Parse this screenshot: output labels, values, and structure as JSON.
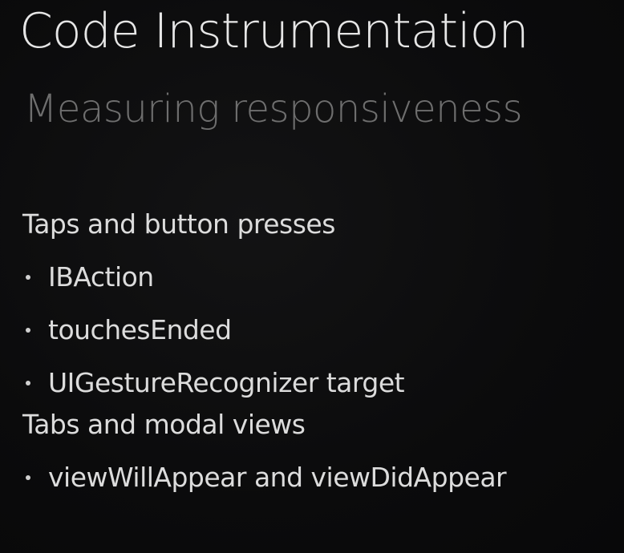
{
  "slide": {
    "title": "Code Instrumentation",
    "subtitle": "Measuring responsiveness",
    "sections": [
      {
        "heading": "Taps and button presses",
        "bullets": [
          "IBAction",
          "touchesEnded",
          "UIGestureRecognizer target"
        ]
      },
      {
        "heading": "Tabs and modal views",
        "bullets": [
          "viewWillAppear and viewDidAppear"
        ]
      }
    ]
  }
}
